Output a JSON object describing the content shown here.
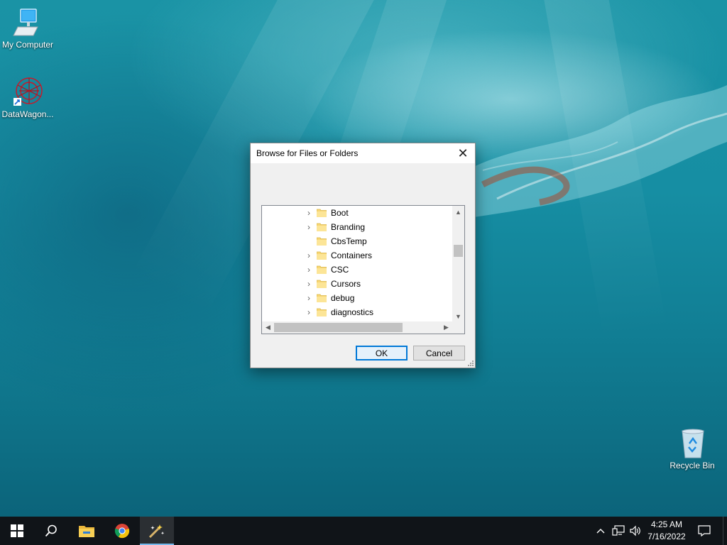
{
  "desktop": {
    "icons": [
      {
        "label": "My Computer",
        "icon": "monitor-icon"
      },
      {
        "label": "DataWagon...",
        "icon": "datawagon-icon"
      },
      {
        "label": "Recycle Bin",
        "icon": "recycle-bin-icon"
      }
    ]
  },
  "dialog": {
    "title": "Browse for Files or Folders",
    "close_label": "✕",
    "tree": {
      "items": [
        {
          "name": "Boot",
          "expandable": true
        },
        {
          "name": "Branding",
          "expandable": true
        },
        {
          "name": "CbsTemp",
          "expandable": false
        },
        {
          "name": "Containers",
          "expandable": true
        },
        {
          "name": "CSC",
          "expandable": true
        },
        {
          "name": "Cursors",
          "expandable": true
        },
        {
          "name": "debug",
          "expandable": true
        },
        {
          "name": "diagnostics",
          "expandable": true
        }
      ]
    },
    "buttons": {
      "ok": "OK",
      "cancel": "Cancel"
    }
  },
  "taskbar": {
    "apps": [
      "start-icon",
      "search-icon",
      "file-explorer-icon",
      "chrome-icon",
      "datawagon-app-icon"
    ],
    "active_app": "datawagon-app-icon",
    "clock": {
      "time": "4:25 AM",
      "date": "7/16/2022"
    }
  },
  "colors": {
    "accent": "#0078d7",
    "taskbar": "#101418",
    "folder": "#f8d775"
  }
}
